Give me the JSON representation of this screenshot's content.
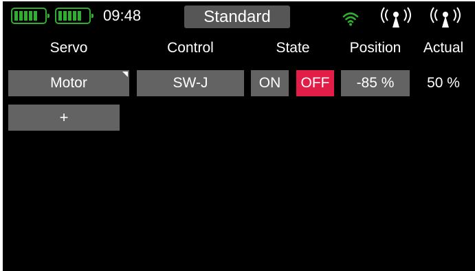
{
  "status": {
    "time": "09:48",
    "mode": "Standard",
    "icons": {
      "battery_1": "battery-full-icon",
      "battery_2": "battery-full-icon",
      "wifi": "wifi-icon",
      "antenna_1": "antenna-signal-icon",
      "antenna_2": "antenna-signal-icon"
    },
    "colors": {
      "battery": "#2fae2f",
      "wifi": "#2fae2f",
      "antenna": "#ffffff"
    }
  },
  "table": {
    "headers": {
      "servo": "Servo",
      "control": "Control",
      "state": "State",
      "position": "Position",
      "actual": "Actual"
    },
    "row": {
      "servo": "Motor",
      "control": "SW-J",
      "state_on": "ON",
      "state_off": "OFF",
      "position": "-85 %",
      "actual": "50 %"
    },
    "add_label": "+"
  },
  "colors": {
    "background": "#000000",
    "button": "#636363",
    "active_state": "#e11d48",
    "text": "#ffffff"
  }
}
